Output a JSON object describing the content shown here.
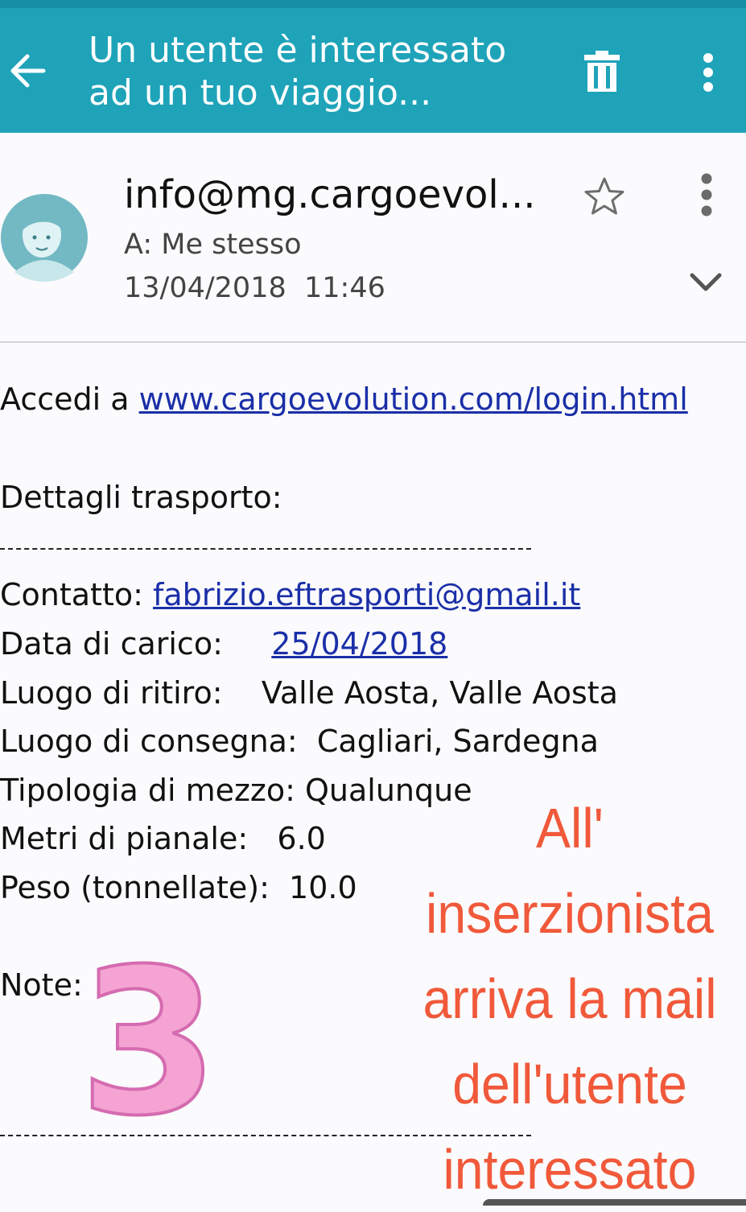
{
  "appbar": {
    "title_line1": "Un utente è interessato",
    "title_line2": "ad un tuo viaggio...",
    "back_icon": "arrow-left-icon",
    "delete_icon": "trash-icon",
    "more_icon": "more-vert-icon",
    "color": "#1ea3b9"
  },
  "message": {
    "sender": "info@mg.cargoevol...",
    "to": "A: Me stesso",
    "date": "13/04/2018",
    "time": "11:46",
    "star_icon": "star-outline-icon",
    "expand_icon": "chevron-down-icon"
  },
  "body": {
    "access_prefix": "Accedi a ",
    "access_link": "www.cargoevolution.com/login.html",
    "details_heading": "Dettagli trasporto:",
    "contact_label": "Contatto: ",
    "contact_value": "fabrizio.eftrasporti@gmail.it",
    "load_date_label": "Data di carico:     ",
    "load_date_value": "25/04/2018",
    "pickup": "Luogo di ritiro:    Valle Aosta, Valle Aosta",
    "delivery": "Luogo di consegna:  Cagliari, Sardegna",
    "vehicle": "Tipologia di mezzo: Qualunque",
    "deck_meters": "Metri di pianale:   6.0",
    "weight": "Peso (tonnellate):  10.0",
    "notes_label": "Note:"
  },
  "overlay": {
    "step_number": "3",
    "annotation_lines": [
      "All'",
      "inserzionista",
      "arriva la mail",
      "dell'utente",
      "interessato"
    ],
    "annotation_color": "#f0593a",
    "step_color": "#f4a3d3"
  }
}
